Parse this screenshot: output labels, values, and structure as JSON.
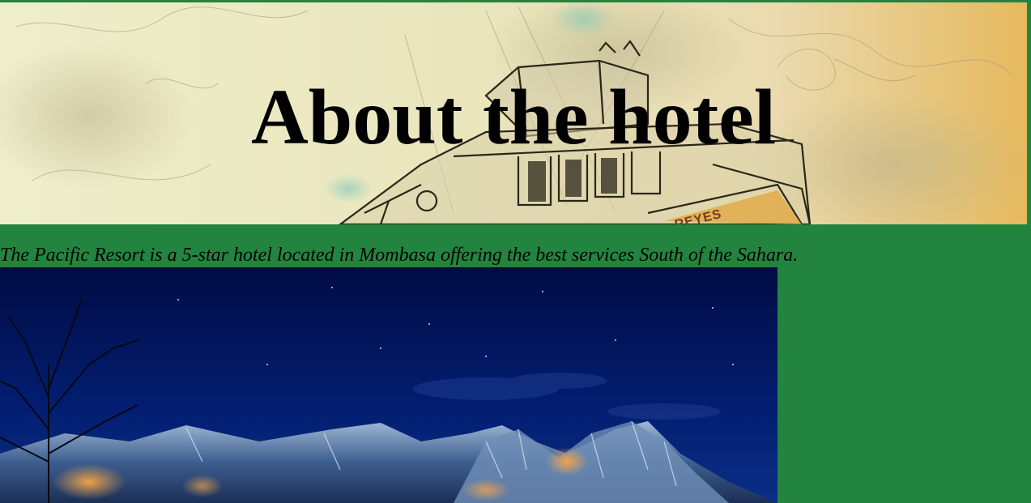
{
  "hero": {
    "title": "About the hotel",
    "image": "sketched-boat-illustration",
    "boat_name": "REYES"
  },
  "intro": {
    "text": "The Pacific Resort is a 5-star hotel located in Mombasa offering the best services South of the Sahara."
  },
  "photo": {
    "image": "snowy-mountain-night-photo"
  },
  "colors": {
    "page_background": "#22843e",
    "hero_base": "#efeecb",
    "hero_accent": "#e5b95e",
    "night_sky": "#021256"
  }
}
